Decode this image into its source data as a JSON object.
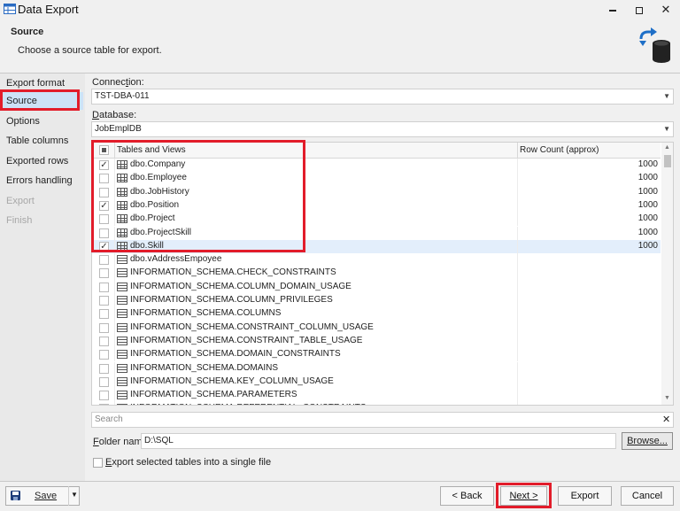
{
  "window": {
    "title": "Data Export",
    "minimize_glyph": "▁",
    "maximize_glyph": "☐",
    "close_glyph": "✕"
  },
  "header": {
    "title": "Source",
    "subtitle": "Choose a source table for export."
  },
  "nav": {
    "items": [
      {
        "label": "Export format",
        "state": "normal"
      },
      {
        "label": "Source",
        "state": "active"
      },
      {
        "label": "Options",
        "state": "normal"
      },
      {
        "label": "Table columns",
        "state": "normal"
      },
      {
        "label": "Exported rows",
        "state": "normal"
      },
      {
        "label": "Errors handling",
        "state": "normal"
      },
      {
        "label": "Export",
        "state": "disabled"
      },
      {
        "label": "Finish",
        "state": "disabled"
      }
    ]
  },
  "connection": {
    "label_pre": "Connec",
    "label_mnemonic": "t",
    "label_post": "ion:",
    "value": "TST-DBA-011"
  },
  "database": {
    "label_mnemonic": "D",
    "label_post": "atabase:",
    "value": "JobEmplDB"
  },
  "grid": {
    "col_name": "Tables and Views",
    "col_count": "Row Count (approx)",
    "header_checkbox": "partial",
    "rows": [
      {
        "name": "dbo.Company",
        "count": "1000",
        "checked": true,
        "kind": "table"
      },
      {
        "name": "dbo.Employee",
        "count": "1000",
        "checked": false,
        "kind": "table"
      },
      {
        "name": "dbo.JobHistory",
        "count": "1000",
        "checked": false,
        "kind": "table"
      },
      {
        "name": "dbo.Position",
        "count": "1000",
        "checked": true,
        "kind": "table"
      },
      {
        "name": "dbo.Project",
        "count": "1000",
        "checked": false,
        "kind": "table"
      },
      {
        "name": "dbo.ProjectSkill",
        "count": "1000",
        "checked": false,
        "kind": "table"
      },
      {
        "name": "dbo.Skill",
        "count": "1000",
        "checked": true,
        "kind": "table",
        "selected": true
      },
      {
        "name": "dbo.vAddressEmpoyee",
        "count": "",
        "checked": false,
        "kind": "view"
      },
      {
        "name": "INFORMATION_SCHEMA.CHECK_CONSTRAINTS",
        "count": "",
        "checked": false,
        "kind": "view"
      },
      {
        "name": "INFORMATION_SCHEMA.COLUMN_DOMAIN_USAGE",
        "count": "",
        "checked": false,
        "kind": "view"
      },
      {
        "name": "INFORMATION_SCHEMA.COLUMN_PRIVILEGES",
        "count": "",
        "checked": false,
        "kind": "view"
      },
      {
        "name": "INFORMATION_SCHEMA.COLUMNS",
        "count": "",
        "checked": false,
        "kind": "view"
      },
      {
        "name": "INFORMATION_SCHEMA.CONSTRAINT_COLUMN_USAGE",
        "count": "",
        "checked": false,
        "kind": "view"
      },
      {
        "name": "INFORMATION_SCHEMA.CONSTRAINT_TABLE_USAGE",
        "count": "",
        "checked": false,
        "kind": "view"
      },
      {
        "name": "INFORMATION_SCHEMA.DOMAIN_CONSTRAINTS",
        "count": "",
        "checked": false,
        "kind": "view"
      },
      {
        "name": "INFORMATION_SCHEMA.DOMAINS",
        "count": "",
        "checked": false,
        "kind": "view"
      },
      {
        "name": "INFORMATION_SCHEMA.KEY_COLUMN_USAGE",
        "count": "",
        "checked": false,
        "kind": "view"
      },
      {
        "name": "INFORMATION_SCHEMA.PARAMETERS",
        "count": "",
        "checked": false,
        "kind": "view"
      },
      {
        "name": "INFORMATION_SCHEMA.REFERENTIAL_CONSTRAINTS",
        "count": "",
        "checked": false,
        "kind": "view"
      }
    ]
  },
  "search": {
    "placeholder": "Search",
    "clear_glyph": "✕"
  },
  "folder": {
    "label_mnemonic": "F",
    "label_post": "older name:",
    "value": "D:\\SQL",
    "browse_label": "Browse..."
  },
  "single_file": {
    "label_mnemonic": "E",
    "label_post": "xport selected tables into a single file",
    "checked": false
  },
  "footer": {
    "save_label": "Save",
    "back_label": "< Back",
    "next_label": "Next >",
    "export_label": "Export",
    "cancel_label": "Cancel"
  },
  "colors": {
    "highlight_box": "#e21c2a",
    "selection": "#cde2f7",
    "accent": "#1e6fc7"
  },
  "icons": {
    "app": "data-export-icon",
    "header": "database-export-icon",
    "save": "floppy-disk-icon"
  }
}
